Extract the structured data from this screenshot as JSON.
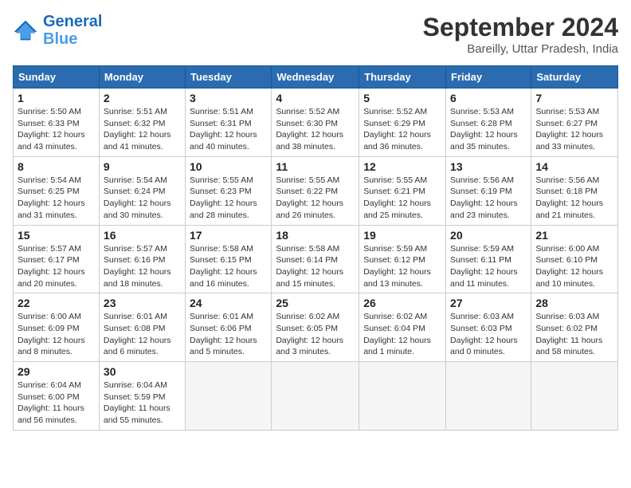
{
  "header": {
    "logo_line1": "General",
    "logo_line2": "Blue",
    "month": "September 2024",
    "location": "Bareilly, Uttar Pradesh, India"
  },
  "weekdays": [
    "Sunday",
    "Monday",
    "Tuesday",
    "Wednesday",
    "Thursday",
    "Friday",
    "Saturday"
  ],
  "weeks": [
    [
      {
        "day": "1",
        "info": "Sunrise: 5:50 AM\nSunset: 6:33 PM\nDaylight: 12 hours\nand 43 minutes."
      },
      {
        "day": "2",
        "info": "Sunrise: 5:51 AM\nSunset: 6:32 PM\nDaylight: 12 hours\nand 41 minutes."
      },
      {
        "day": "3",
        "info": "Sunrise: 5:51 AM\nSunset: 6:31 PM\nDaylight: 12 hours\nand 40 minutes."
      },
      {
        "day": "4",
        "info": "Sunrise: 5:52 AM\nSunset: 6:30 PM\nDaylight: 12 hours\nand 38 minutes."
      },
      {
        "day": "5",
        "info": "Sunrise: 5:52 AM\nSunset: 6:29 PM\nDaylight: 12 hours\nand 36 minutes."
      },
      {
        "day": "6",
        "info": "Sunrise: 5:53 AM\nSunset: 6:28 PM\nDaylight: 12 hours\nand 35 minutes."
      },
      {
        "day": "7",
        "info": "Sunrise: 5:53 AM\nSunset: 6:27 PM\nDaylight: 12 hours\nand 33 minutes."
      }
    ],
    [
      {
        "day": "8",
        "info": "Sunrise: 5:54 AM\nSunset: 6:25 PM\nDaylight: 12 hours\nand 31 minutes."
      },
      {
        "day": "9",
        "info": "Sunrise: 5:54 AM\nSunset: 6:24 PM\nDaylight: 12 hours\nand 30 minutes."
      },
      {
        "day": "10",
        "info": "Sunrise: 5:55 AM\nSunset: 6:23 PM\nDaylight: 12 hours\nand 28 minutes."
      },
      {
        "day": "11",
        "info": "Sunrise: 5:55 AM\nSunset: 6:22 PM\nDaylight: 12 hours\nand 26 minutes."
      },
      {
        "day": "12",
        "info": "Sunrise: 5:55 AM\nSunset: 6:21 PM\nDaylight: 12 hours\nand 25 minutes."
      },
      {
        "day": "13",
        "info": "Sunrise: 5:56 AM\nSunset: 6:19 PM\nDaylight: 12 hours\nand 23 minutes."
      },
      {
        "day": "14",
        "info": "Sunrise: 5:56 AM\nSunset: 6:18 PM\nDaylight: 12 hours\nand 21 minutes."
      }
    ],
    [
      {
        "day": "15",
        "info": "Sunrise: 5:57 AM\nSunset: 6:17 PM\nDaylight: 12 hours\nand 20 minutes."
      },
      {
        "day": "16",
        "info": "Sunrise: 5:57 AM\nSunset: 6:16 PM\nDaylight: 12 hours\nand 18 minutes."
      },
      {
        "day": "17",
        "info": "Sunrise: 5:58 AM\nSunset: 6:15 PM\nDaylight: 12 hours\nand 16 minutes."
      },
      {
        "day": "18",
        "info": "Sunrise: 5:58 AM\nSunset: 6:14 PM\nDaylight: 12 hours\nand 15 minutes."
      },
      {
        "day": "19",
        "info": "Sunrise: 5:59 AM\nSunset: 6:12 PM\nDaylight: 12 hours\nand 13 minutes."
      },
      {
        "day": "20",
        "info": "Sunrise: 5:59 AM\nSunset: 6:11 PM\nDaylight: 12 hours\nand 11 minutes."
      },
      {
        "day": "21",
        "info": "Sunrise: 6:00 AM\nSunset: 6:10 PM\nDaylight: 12 hours\nand 10 minutes."
      }
    ],
    [
      {
        "day": "22",
        "info": "Sunrise: 6:00 AM\nSunset: 6:09 PM\nDaylight: 12 hours\nand 8 minutes."
      },
      {
        "day": "23",
        "info": "Sunrise: 6:01 AM\nSunset: 6:08 PM\nDaylight: 12 hours\nand 6 minutes."
      },
      {
        "day": "24",
        "info": "Sunrise: 6:01 AM\nSunset: 6:06 PM\nDaylight: 12 hours\nand 5 minutes."
      },
      {
        "day": "25",
        "info": "Sunrise: 6:02 AM\nSunset: 6:05 PM\nDaylight: 12 hours\nand 3 minutes."
      },
      {
        "day": "26",
        "info": "Sunrise: 6:02 AM\nSunset: 6:04 PM\nDaylight: 12 hours\nand 1 minute."
      },
      {
        "day": "27",
        "info": "Sunrise: 6:03 AM\nSunset: 6:03 PM\nDaylight: 12 hours\nand 0 minutes."
      },
      {
        "day": "28",
        "info": "Sunrise: 6:03 AM\nSunset: 6:02 PM\nDaylight: 11 hours\nand 58 minutes."
      }
    ],
    [
      {
        "day": "29",
        "info": "Sunrise: 6:04 AM\nSunset: 6:00 PM\nDaylight: 11 hours\nand 56 minutes."
      },
      {
        "day": "30",
        "info": "Sunrise: 6:04 AM\nSunset: 5:59 PM\nDaylight: 11 hours\nand 55 minutes."
      },
      null,
      null,
      null,
      null,
      null
    ]
  ]
}
